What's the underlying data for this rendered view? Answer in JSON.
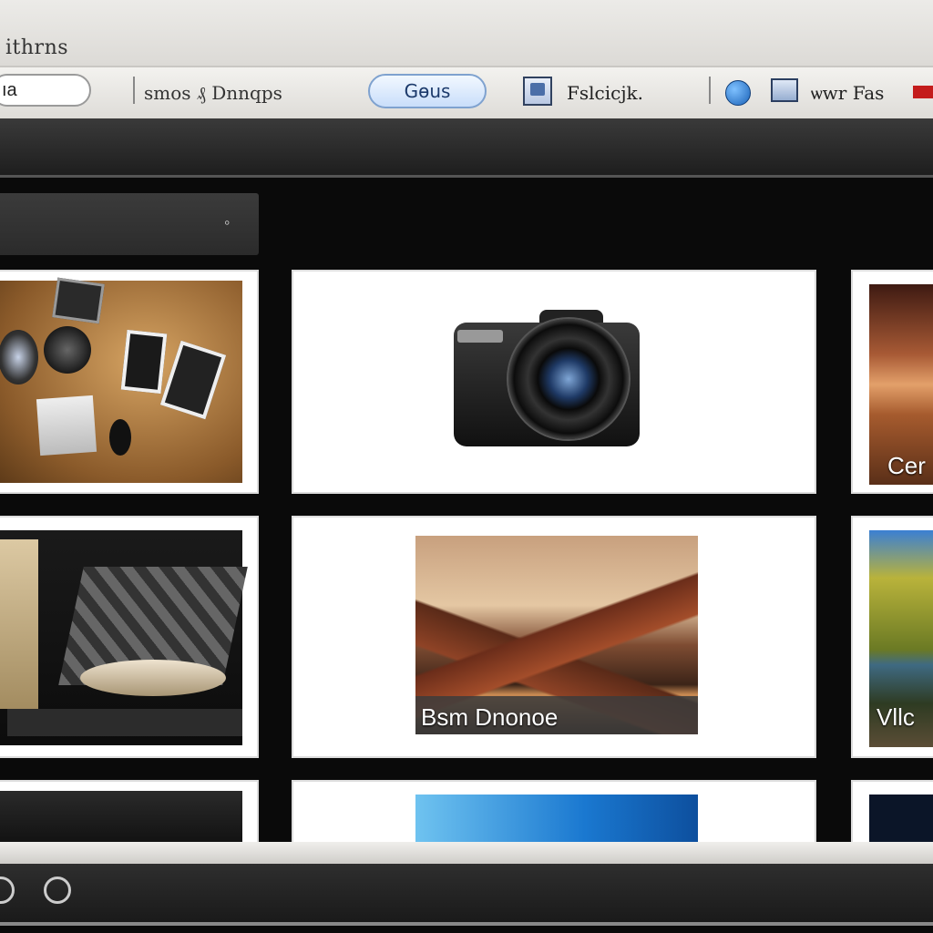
{
  "window": {
    "title": "ithrns"
  },
  "toolbar": {
    "search_value": "ıa",
    "nav_text": "smos ₰ Dnnqps",
    "go_label": "Gѳus",
    "file_label": "Fslcicjk.",
    "view_label": "ѡwr Fas",
    "icons": [
      "file-icon",
      "globe-icon",
      "image-icon",
      "flag-icon"
    ]
  },
  "panel": {
    "close_glyph": "◦"
  },
  "grid": {
    "tiles": [
      {
        "name": "desk-gadgets",
        "caption": ""
      },
      {
        "name": "camera",
        "caption": ""
      },
      {
        "name": "desert-sunset",
        "caption": "Cer"
      },
      {
        "name": "keyboard",
        "caption": ""
      },
      {
        "name": "valley-river",
        "caption": "Bsm Dnonoe"
      },
      {
        "name": "green-hills",
        "caption": "Vllc"
      },
      {
        "name": "bottom-left",
        "caption": ""
      },
      {
        "name": "bottom-middle",
        "caption": ""
      },
      {
        "name": "bottom-right",
        "caption": ""
      }
    ]
  },
  "colors": {
    "accent": "#1a62b8",
    "flag": "#c41c1c",
    "background": "#0a0a0a"
  }
}
